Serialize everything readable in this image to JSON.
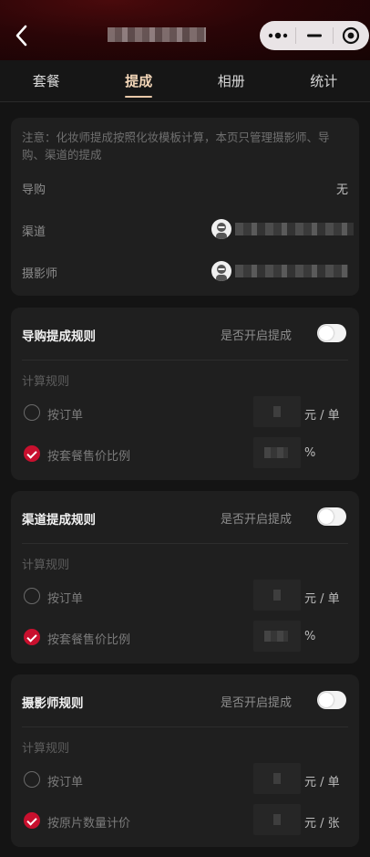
{
  "tabs": [
    "套餐",
    "提成",
    "相册",
    "统计"
  ],
  "active_tab": "提成",
  "info": {
    "note": "注意：化妆师提成按照化妆模板计算，本页只管理摄影师、导购、渠道的提成",
    "guide_label": "导购",
    "guide_value": "无",
    "channel_label": "渠道",
    "photographer_label": "摄影师"
  },
  "sections": [
    {
      "title": "导购提成规则",
      "switch_label": "是否开启提成",
      "calc_label": "计算规则",
      "options": [
        {
          "label": "按订单",
          "unit": "元 / 单",
          "checked": false
        },
        {
          "label": "按套餐售价比例",
          "unit": "%",
          "checked": true
        }
      ]
    },
    {
      "title": "渠道提成规则",
      "switch_label": "是否开启提成",
      "calc_label": "计算规则",
      "options": [
        {
          "label": "按订单",
          "unit": "元 / 单",
          "checked": false
        },
        {
          "label": "按套餐售价比例",
          "unit": "%",
          "checked": true
        }
      ]
    },
    {
      "title": "摄影师规则",
      "switch_label": "是否开启提成",
      "calc_label": "计算规则",
      "options": [
        {
          "label": "按订单",
          "unit": "元 / 单",
          "checked": false
        },
        {
          "label": "按原片数量计价",
          "unit": "元 / 张",
          "checked": true
        }
      ]
    }
  ],
  "colors": {
    "accent": "#c8102e",
    "tab_active": "#f3d6b8",
    "card": "#1f1f1f",
    "background": "#141414"
  }
}
